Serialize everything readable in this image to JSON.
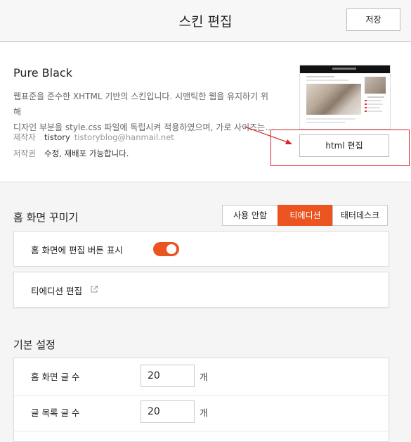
{
  "header": {
    "title": "스킨 편집",
    "save_label": "저장"
  },
  "skin": {
    "name": "Pure Black",
    "description_line1": "웹표준을 준수한 XHTML 기반의 스킨입니다. 시맨틱한 웹을 유지하기 위해",
    "description_line2": "디자인 부분을 style.css 파일에 독립시켜 적용하였으며, 가로 사이즈는…",
    "author_label": "제작자",
    "author_name": "tistory",
    "author_email": "tistoryblog@hanmail.net",
    "license_label": "저작권",
    "license_value": "수정, 재배포 가능합니다.",
    "html_edit_label": "html 편집"
  },
  "home_decor": {
    "title": "홈 화면 꾸미기",
    "segments": [
      {
        "label": "사용 안함",
        "active": false
      },
      {
        "label": "티에디션",
        "active": true
      },
      {
        "label": "태터데스크",
        "active": false
      }
    ],
    "show_edit_button_label": "홈 화면에 편집 버튼 표시",
    "show_edit_button_on": true,
    "tedition_edit_label": "티에디션 편집"
  },
  "basic_settings": {
    "title": "기본 설정",
    "rows": [
      {
        "label": "홈 화면 글 수",
        "value": "20",
        "unit": "개"
      },
      {
        "label": "글 목록 글 수",
        "value": "20",
        "unit": "개"
      }
    ]
  },
  "colors": {
    "accent": "#eb531f",
    "annotation": "#d9252d"
  },
  "icons": {
    "external": "external-link-icon"
  }
}
